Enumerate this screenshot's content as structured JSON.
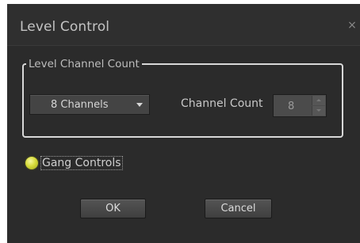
{
  "window": {
    "title": "Level Control",
    "close_glyph": "×"
  },
  "group": {
    "legend": "Level Channel Count",
    "dropdown": {
      "selected": "8 Channels",
      "arrow_icon": "dropdown-arrow-icon"
    },
    "channel_count": {
      "label": "Channel Count",
      "value": "8",
      "enabled": false
    }
  },
  "gang": {
    "label": "Gang Controls",
    "checked": true,
    "led_color": "#d6db3a"
  },
  "buttons": {
    "ok": "OK",
    "cancel": "Cancel"
  },
  "colors": {
    "background": "#2b2b2b",
    "text": "#c8c8c8",
    "groupbox_border": "#d8d8d8"
  }
}
